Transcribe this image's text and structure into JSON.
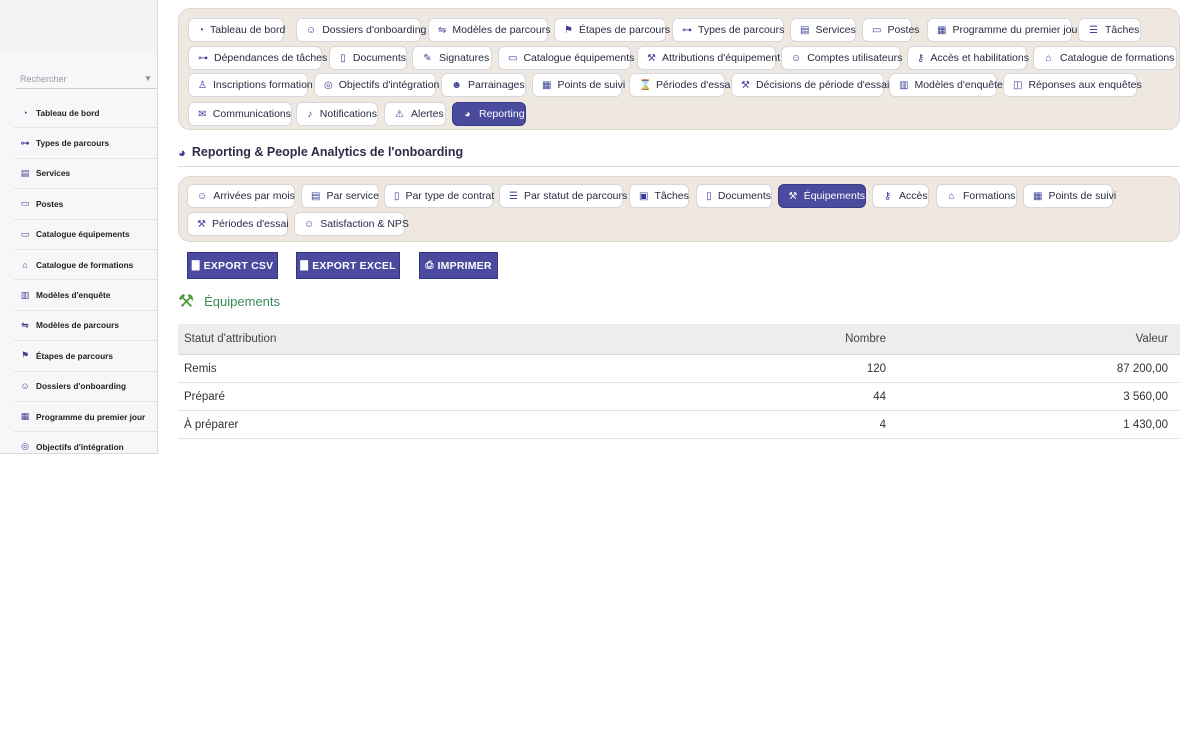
{
  "sidebar": {
    "search_placeholder": "Rechercher",
    "items": [
      {
        "icon": "gauge-icon",
        "glyph": "◔",
        "label": "Tableau de bord"
      },
      {
        "icon": "hierarchy-icon",
        "glyph": "⊶",
        "label": "Types de parcours"
      },
      {
        "icon": "building-icon",
        "glyph": "▤",
        "label": "Services"
      },
      {
        "icon": "badge-icon",
        "glyph": "▭",
        "label": "Postes"
      },
      {
        "icon": "laptop-icon",
        "glyph": "▭",
        "label": "Catalogue équipements"
      },
      {
        "icon": "graduation-cap-icon",
        "glyph": "⌂",
        "label": "Catalogue de formations"
      },
      {
        "icon": "clipboard-icon",
        "glyph": "▥",
        "label": "Modèles d'enquête"
      },
      {
        "icon": "signs-icon",
        "glyph": "⇋",
        "label": "Modèles de parcours"
      },
      {
        "icon": "flag-icon",
        "glyph": "⚑",
        "label": "Étapes de parcours"
      },
      {
        "icon": "user-plus-icon",
        "glyph": "☺",
        "label": "Dossiers d'onboarding"
      },
      {
        "icon": "calendar-icon",
        "glyph": "▦",
        "label": "Programme du premier jour"
      },
      {
        "icon": "target-icon",
        "glyph": "◎",
        "label": "Objectifs d'intégration"
      }
    ]
  },
  "top_tabs": [
    {
      "icon": "gauge-icon",
      "glyph": "◔",
      "label": "Tableau de bord"
    },
    {
      "icon": "user-plus-icon",
      "glyph": "☺",
      "label": "Dossiers d'onboarding"
    },
    {
      "icon": "signs-icon",
      "glyph": "⇋",
      "label": "Modèles de parcours"
    },
    {
      "icon": "flag-icon",
      "glyph": "⚑",
      "label": "Étapes de parcours"
    },
    {
      "icon": "hierarchy-icon",
      "glyph": "⊶",
      "label": "Types de parcours"
    },
    {
      "icon": "building-icon",
      "glyph": "▤",
      "label": "Services"
    },
    {
      "icon": "badge-icon",
      "glyph": "▭",
      "label": "Postes"
    },
    {
      "icon": "calendar-icon",
      "glyph": "▦",
      "label": "Programme du premier jour"
    },
    {
      "icon": "list-icon",
      "glyph": "☰",
      "label": "Tâches"
    },
    {
      "icon": "dependency-icon",
      "glyph": "⊶",
      "label": "Dépendances de tâches"
    },
    {
      "icon": "file-icon",
      "glyph": "▯",
      "label": "Documents"
    },
    {
      "icon": "signature-icon",
      "glyph": "✎",
      "label": "Signatures"
    },
    {
      "icon": "laptop-icon",
      "glyph": "▭",
      "label": "Catalogue équipements"
    },
    {
      "icon": "dolly-icon",
      "glyph": "⚒",
      "label": "Attributions d'équipement"
    },
    {
      "icon": "users-cog-icon",
      "glyph": "☺",
      "label": "Comptes utilisateurs"
    },
    {
      "icon": "key-icon",
      "glyph": "⚷",
      "label": "Accès et habilitations"
    },
    {
      "icon": "graduation-cap-icon",
      "glyph": "⌂",
      "label": "Catalogue de formations"
    },
    {
      "icon": "user-tie-icon",
      "glyph": "♙",
      "label": "Inscriptions formation"
    },
    {
      "icon": "target-icon",
      "glyph": "◎",
      "label": "Objectifs d'intégration"
    },
    {
      "icon": "users-icon",
      "glyph": "☻",
      "label": "Parrainages"
    },
    {
      "icon": "calendar-check-icon",
      "glyph": "▦",
      "label": "Points de suivi"
    },
    {
      "icon": "hourglass-icon",
      "glyph": "⌛",
      "label": "Périodes d'essai"
    },
    {
      "icon": "gavel-icon",
      "glyph": "⚒",
      "label": "Décisions de période d'essai"
    },
    {
      "icon": "clipboard-list-icon",
      "glyph": "▥",
      "label": "Modèles d'enquête"
    },
    {
      "icon": "chart-line-icon",
      "glyph": "◫",
      "label": "Réponses aux enquêtes"
    },
    {
      "icon": "envelope-icon",
      "glyph": "✉",
      "label": "Communications"
    },
    {
      "icon": "bell-icon",
      "glyph": "♪",
      "label": "Notifications"
    },
    {
      "icon": "warning-icon",
      "glyph": "⚠",
      "label": "Alertes"
    },
    {
      "icon": "chart-pie-icon",
      "glyph": "◕",
      "label": "Reporting",
      "active": true
    }
  ],
  "section_title": "Reporting & People Analytics de l'onboarding",
  "report_tabs": [
    {
      "icon": "user-plus-icon",
      "glyph": "☺",
      "label": "Arrivées par mois"
    },
    {
      "icon": "building-icon",
      "glyph": "▤",
      "label": "Par service"
    },
    {
      "icon": "file-contract-icon",
      "glyph": "▯",
      "label": "Par type de contrat"
    },
    {
      "icon": "list-icon",
      "glyph": "☰",
      "label": "Par statut de parcours"
    },
    {
      "icon": "tasks-icon",
      "glyph": "▣",
      "label": "Tâches"
    },
    {
      "icon": "file-icon",
      "glyph": "▯",
      "label": "Documents"
    },
    {
      "icon": "dolly-icon",
      "glyph": "⚒",
      "label": "Équipements",
      "active": true
    },
    {
      "icon": "key-icon",
      "glyph": "⚷",
      "label": "Accès"
    },
    {
      "icon": "graduation-cap-icon",
      "glyph": "⌂",
      "label": "Formations"
    },
    {
      "icon": "calendar-check-icon",
      "glyph": "▦",
      "label": "Points de suivi"
    },
    {
      "icon": "gavel-icon",
      "glyph": "⚒",
      "label": "Périodes d'essai"
    },
    {
      "icon": "smile-icon",
      "glyph": "☺",
      "label": "Satisfaction & NPS"
    }
  ],
  "export_buttons": {
    "csv": "EXPORT CSV",
    "excel": "EXPORT EXCEL",
    "print": "IMPRIMER"
  },
  "sub_heading": "Équipements",
  "table": {
    "headers": [
      "Statut d'attribution",
      "Nombre",
      "Valeur"
    ],
    "rows": [
      [
        "Remis",
        "120",
        "87 200,00"
      ],
      [
        "Préparé",
        "44",
        "3 560,00"
      ],
      [
        "À préparer",
        "4",
        "1 430,00"
      ]
    ]
  },
  "colors": {
    "accent": "#4a4a9e",
    "panel_bg": "#eee8e0",
    "sub_heading": "#3a8a5a"
  }
}
